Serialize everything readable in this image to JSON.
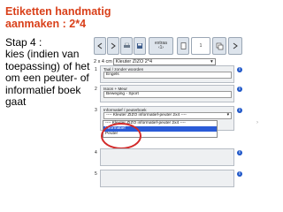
{
  "title": "Etiketten handmatig\naanmaken : 2*4",
  "step": "Stap 4 :\nkies (indien van\ntoepassing) of het\nom een peuter- of\ninformatief boek\ngaat",
  "toolbar": {
    "extra_label": "extraa\n‹1›",
    "counter": "1"
  },
  "label_format": {
    "prefix": "2 x 4 cm",
    "value": "Kleuter ZIZO 2*4"
  },
  "fields": {
    "taal_header": "Taal / zonder woorden",
    "taal_value": "Engels",
    "genre_header": "Isoon + Meur",
    "genre_value": "Beweging - Sport",
    "info_header": "Informatief / peuterboek",
    "info_value": "---- Kleuter ZIZO informatief-peuter 2x4 ----",
    "dropdown_options": [
      "---- Kleuter ZIZO informatief-peuter 2x4 ----",
      "Informatief",
      "Peuter"
    ]
  },
  "field_numbers": [
    "1",
    "2",
    "3",
    "4",
    "5"
  ],
  "colors": {
    "title": "#d9401a",
    "circle": "#d22a2a",
    "selection": "#2a5bd7"
  }
}
